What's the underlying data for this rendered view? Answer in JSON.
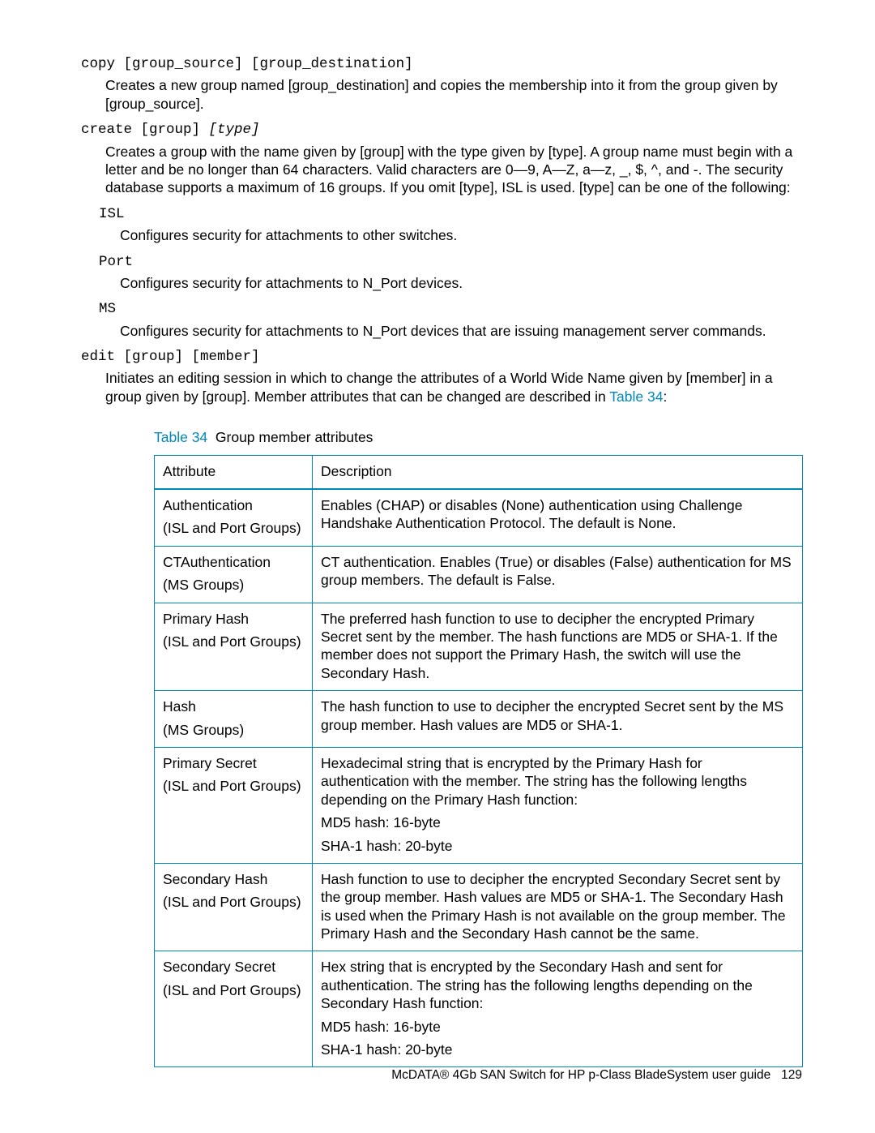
{
  "commands": {
    "copy": {
      "syntax": "copy [group_source] [group_destination]",
      "desc": "Creates a new group named [group_destination] and copies the membership into it from the group given by [group_source]."
    },
    "create": {
      "syntax_prefix": "create [group] ",
      "syntax_italic": "[type]",
      "desc": "Creates a group with the name given by [group] with the type given by [type]. A group name must begin with a letter and be no longer than 64 characters. Valid characters are 0—9, A—Z, a—z, _, $, ^, and -. The security database supports a maximum of 16 groups. If you omit [type], ISL is used. [type] can be one of the following:",
      "types": {
        "isl": {
          "key": "ISL",
          "desc": "Configures security for attachments to other switches."
        },
        "port": {
          "key": "Port",
          "desc": "Configures security for attachments to N_Port devices."
        },
        "ms": {
          "key": "MS",
          "desc": "Configures security for attachments to N_Port devices that are issuing management server commands."
        }
      }
    },
    "edit": {
      "syntax": "edit [group] [member]",
      "desc_prefix": "Initiates an editing session in which to change the attributes of a World Wide Name given by [member] in a group given by [group]. Member attributes that can be changed are described in ",
      "desc_link": "Table 34",
      "desc_suffix": ":"
    }
  },
  "table": {
    "caption_num": "Table 34",
    "caption_text": "Group member attributes",
    "head": {
      "c1": "Attribute",
      "c2": "Description"
    },
    "rows": [
      {
        "attr1": "Authentication",
        "attr2": "(ISL and Port Groups)",
        "desc": [
          "Enables (CHAP) or disables (None) authentication using Challenge Handshake Authentication Protocol. The default is None."
        ]
      },
      {
        "attr1": "CTAuthentication",
        "attr2": "(MS Groups)",
        "desc": [
          "CT authentication. Enables (True) or disables (False) authentication for MS group members. The default is False."
        ]
      },
      {
        "attr1": "Primary Hash",
        "attr2": "(ISL and Port Groups)",
        "desc": [
          "The preferred hash function to use to decipher the encrypted Primary Secret sent by the member. The hash functions are MD5 or SHA-1. If the member does not support the Primary Hash, the switch will use the Secondary Hash."
        ]
      },
      {
        "attr1": "Hash",
        "attr2": "(MS Groups)",
        "desc": [
          "The hash function to use to decipher the encrypted Secret sent by the MS group member. Hash values are MD5 or SHA-1."
        ]
      },
      {
        "attr1": "Primary Secret",
        "attr2": "(ISL and Port Groups)",
        "desc": [
          "Hexadecimal string that is encrypted by the Primary Hash for authentication with the member. The string has the following lengths depending on the Primary Hash function:",
          "MD5 hash: 16-byte",
          "SHA-1 hash: 20-byte"
        ]
      },
      {
        "attr1": "Secondary Hash",
        "attr2": "(ISL and Port Groups)",
        "desc": [
          "Hash function to use to decipher the encrypted Secondary Secret sent by the group member. Hash values are MD5 or SHA-1. The Secondary Hash is used when the Primary Hash is not available on the group member. The Primary Hash and the Secondary Hash cannot be the same."
        ]
      },
      {
        "attr1": "Secondary Secret",
        "attr2": "(ISL and Port Groups)",
        "desc": [
          "Hex string that is encrypted by the Secondary Hash and sent for authentication. The string has the following lengths depending on the Secondary Hash function:",
          "MD5 hash: 16-byte",
          "SHA-1 hash: 20-byte"
        ]
      }
    ]
  },
  "footer": {
    "text": "McDATA® 4Gb SAN Switch for HP p-Class BladeSystem user guide",
    "page": "129"
  }
}
